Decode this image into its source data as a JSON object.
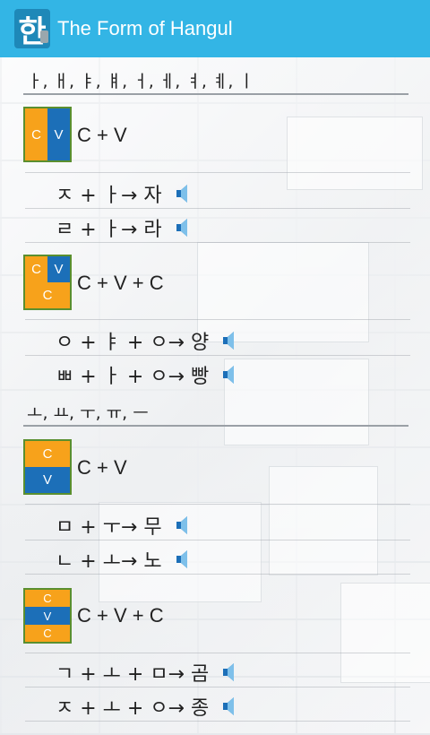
{
  "app": {
    "title": "The Form of Hangul",
    "icon_glyph": "한"
  },
  "sections": {
    "vowels_vertical": "ㅏ, ㅐ, ㅑ, ㅒ, ㅓ, ㅔ, ㅕ, ㅖ, ㅣ",
    "vowels_horizontal": "ㅗ, ㅛ, ㅜ, ㅠ, ㅡ"
  },
  "groups": [
    {
      "formula": "C + V",
      "cells": [
        "C",
        "V"
      ],
      "examples": [
        "ㅈ + ㅏ→ 자",
        "ㄹ + ㅏ→ 라"
      ]
    },
    {
      "formula": "C + V + C",
      "cells": [
        "C",
        "V",
        "C"
      ],
      "examples": [
        "ㅇ + ㅑ + ㅇ→ 양",
        "ㅃ + ㅏ + ㅇ→ 빵"
      ]
    },
    {
      "formula": "C + V",
      "cells": [
        "C",
        "V"
      ],
      "examples": [
        "ㅁ + ㅜ→ 무",
        "ㄴ + ㅗ→ 노"
      ]
    },
    {
      "formula": "C + V + C",
      "cells": [
        "C",
        "V",
        "C"
      ],
      "examples": [
        "ㄱ + ㅗ + ㅁ→ 곰",
        "ㅈ + ㅗ + ㅇ→ 종"
      ]
    }
  ],
  "colors": {
    "appbar": "#33b5e5",
    "consonant": "#f7a21b",
    "vowel": "#1c6fb8"
  },
  "icons": {
    "speaker": "speaker-icon"
  }
}
